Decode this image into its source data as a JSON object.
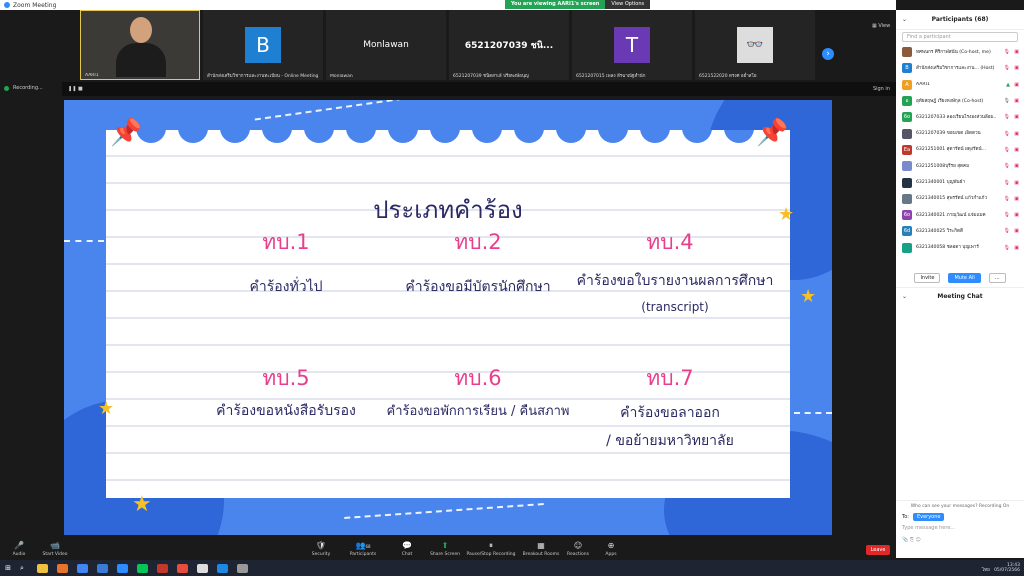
{
  "window": {
    "title": "Zoom Meeting"
  },
  "share_banner": {
    "status": "You are viewing AARI1's screen",
    "view_options": "View Options"
  },
  "view_label": "View",
  "thumbnails": [
    {
      "name": "AARI1",
      "type": "video"
    },
    {
      "name": "สำนักส่งเสริมวิชาการและงานทะเบียน - Online Meeting",
      "initial": "B",
      "color": "#1f7fd0"
    },
    {
      "name": "Monlawan",
      "big": "Monlawan"
    },
    {
      "name": "6521207039 ชนิดสาเล้ ปรียพงษ์อนุญ",
      "big": "6521207039 ชนิ..."
    },
    {
      "name": "6521207015 เพลง ลีรฉาณัฐสำนัก",
      "initial": "T",
      "color": "#6a3ab5"
    },
    {
      "name": "6521522020 ดรงศ อย่ำสโย",
      "type": "glasses"
    }
  ],
  "recording": {
    "label": "Recording..."
  },
  "sharebar": {
    "sign_in": "Sign in"
  },
  "slide": {
    "title": "ประเภทคำร้อง",
    "items": [
      {
        "code": "ทบ.1",
        "desc": "คำร้องทั่วไป",
        "desc2": ""
      },
      {
        "code": "ทบ.2",
        "desc": "คำร้องขอมีบัตรนักศึกษา",
        "desc2": ""
      },
      {
        "code": "ทบ.4",
        "desc": "คำร้องขอใบรายงานผลการศึกษา",
        "desc2": "(transcript)"
      },
      {
        "code": "ทบ.5",
        "desc": "คำร้องขอหนังสือรับรอง",
        "desc2": ""
      },
      {
        "code": "ทบ.6",
        "desc": "คำร้องขอพักการเรียน /  คืนสภาพ",
        "desc2": ""
      },
      {
        "code": "ทบ.7",
        "desc": "คำร้องขอลาออก",
        "desc2": "/ ขอย้ายมหาวิทยาลัย"
      }
    ]
  },
  "participants": {
    "header": "Participants (68)",
    "search_placeholder": "Find a participant",
    "list": [
      {
        "name": "ทศพนกร ศิริกาฬสนั่น (Co-host, me)",
        "initial": "",
        "color": "#8a5a3a"
      },
      {
        "name": "สำนักส่งเสริมวิชาการและงาน... (Host)",
        "initial": "B",
        "color": "#1f7fd0"
      },
      {
        "name": "AARI1",
        "initial": "A",
        "color": "#f0a020"
      },
      {
        "name": "อุทัยสฤษฎ์ เรียงหงษ์กุล (Co-host)",
        "initial": "อ",
        "color": "#23a455"
      },
      {
        "name": "6321207033 ลองเรียนไรงองส่วนลีอม...",
        "initial": "6o",
        "color": "#23a455"
      },
      {
        "name": "6321207039 ขอบเขต เอ็ดตวน",
        "initial": "",
        "color": "#556"
      },
      {
        "name": "6321251001 สุดารัตน์ ผดุงรัตน์...",
        "initial": "Ea",
        "color": "#c0392b"
      },
      {
        "name": "6321251008บุรีรย สุดคม",
        "initial": "",
        "color": "#7a8acb"
      },
      {
        "name": "6321340001 บุญพันธ์า",
        "initial": "",
        "color": "#234"
      },
      {
        "name": "6321340015 สุพรรัตน์ แก้วกำแก้ว",
        "initial": "",
        "color": "#678"
      },
      {
        "name": "6321340021 ภาณุวัฒน์ แจ่มแมค",
        "initial": "6o",
        "color": "#8e44ad"
      },
      {
        "name": "6321340025 วิระกิตติ์",
        "initial": "6d",
        "color": "#2980b9"
      },
      {
        "name": "6321340058 ชลอดา บุญเพาร์",
        "initial": "",
        "color": "#16a085"
      }
    ],
    "invite": "Invite",
    "mute_all": "Mute All",
    "more": "..."
  },
  "chat": {
    "header": "Meeting Chat",
    "who_can_see": "Who can see your messages? Recording On",
    "to_label": "To:",
    "to_value": "Everyone",
    "placeholder": "Type message here..."
  },
  "toolbar": {
    "items": [
      {
        "label": "Audio",
        "icon": "🎤"
      },
      {
        "label": "Start Video",
        "icon": "📹"
      },
      {
        "label": "Security",
        "icon": "🛡"
      },
      {
        "label": "Participants",
        "icon": "👥"
      },
      {
        "label": "Chat",
        "icon": "💬"
      },
      {
        "label": "Share Screen",
        "icon": "⬆"
      },
      {
        "label": "Pause/Stop Recording",
        "icon": "⏸"
      },
      {
        "label": "Breakout Rooms",
        "icon": "▦"
      },
      {
        "label": "Reactions",
        "icon": "☺"
      },
      {
        "label": "Apps",
        "icon": "⊕"
      }
    ],
    "participant_count": "68",
    "leave": "Leave"
  },
  "taskbar": {
    "lang": "ไทย",
    "time": "13:43",
    "date": "05/07/2566"
  },
  "colors": {
    "slide_bg": "#4a85ee",
    "code": "#e83e8c",
    "text": "#2b2a63",
    "accent": "#2d8cff"
  }
}
